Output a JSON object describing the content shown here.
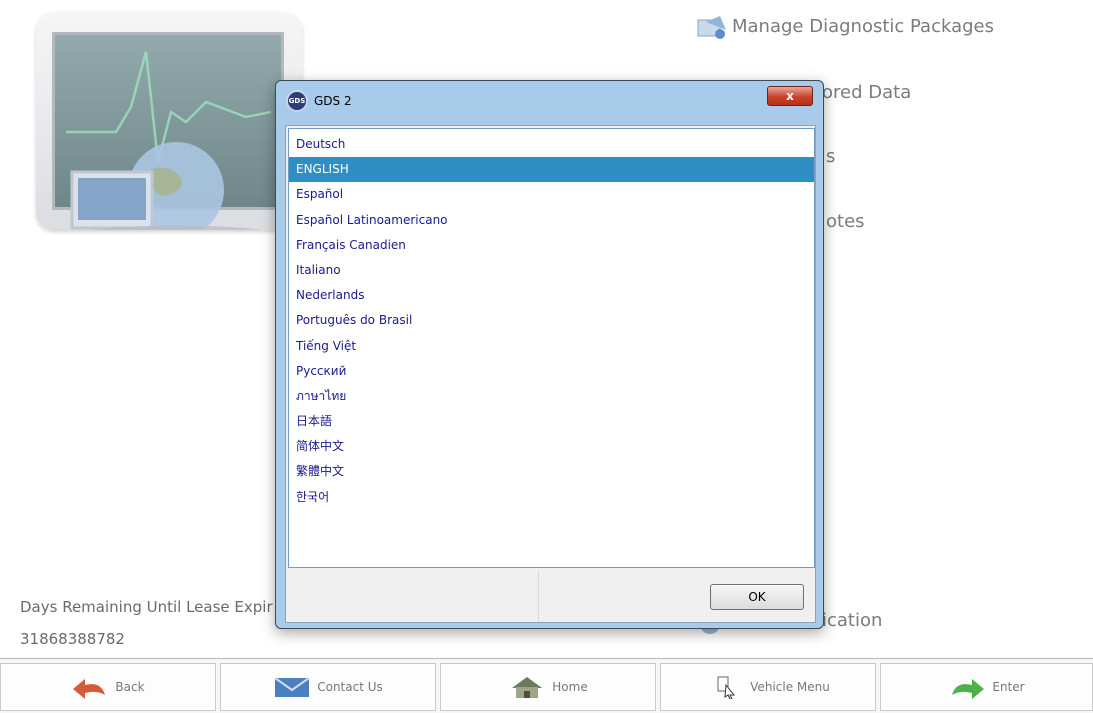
{
  "background": {
    "menu_items": [
      {
        "label": "Manage Diagnostic Packages",
        "icon": "packages-icon"
      },
      {
        "label": "ored Data",
        "icon": "data-icon"
      },
      {
        "label": "s",
        "icon": "blank-icon"
      },
      {
        "label": "otes",
        "icon": "blank-icon"
      },
      {
        "label": "ication",
        "icon": "application-icon"
      }
    ],
    "lease_label": "Days Remaining Until Lease Expir",
    "lease_code": "31868388782"
  },
  "toolbar": {
    "back": "Back",
    "contact": "Contact Us",
    "home": "Home",
    "vehicle_menu": "Vehicle Menu",
    "enter": "Enter"
  },
  "dialog": {
    "title": "GDS 2",
    "logo_text": "GDS",
    "close_label": "x",
    "ok_label": "OK",
    "selected_index": 1,
    "languages": [
      "Deutsch",
      "ENGLISH",
      "Español",
      "Español Latinoamericano",
      "Français Canadien",
      "Italiano",
      "Nederlands",
      "Português do Brasil",
      "Tiếng Việt",
      "Русский",
      "ภาษาไทย",
      "日本語",
      "简体中文",
      "繁體中文",
      "한국어"
    ]
  },
  "colors": {
    "selection": "#2f8fc5",
    "dialog_frame": "#a7cbe9",
    "list_text": "#1a1a8c",
    "close_red": "#c7432c"
  }
}
